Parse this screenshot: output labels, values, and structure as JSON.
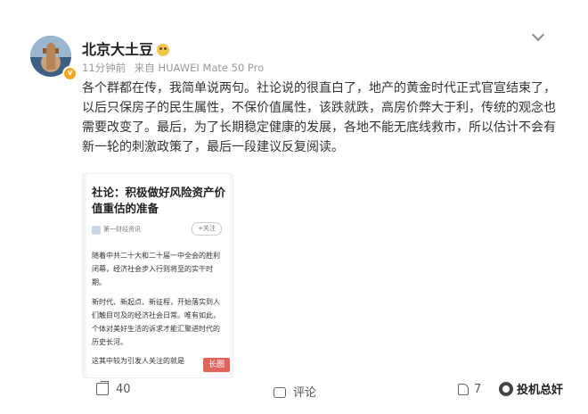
{
  "post": {
    "author": "北京大土豆",
    "time": "11分钟前",
    "source": "来自 HUAWEI Mate 50 Pro",
    "text": "各个群都在传，我简单说两句。社论说的很直白了，地产的黄金时代正式官宣结束了，以后只保房子的民生属性，不保价值属性，该跌就跌，高房价弊大于利，传统的观念也需要改变了。最后，为了长期稳定健康的发展，各地不能无底线救市，所以估计不会有新一轮的刺激政策了，最后一段建议反复阅读。"
  },
  "article": {
    "title": "社论：积极做好风险资产价值重估的准备",
    "source_name": "第一财经资讯",
    "follow_label": "+关注",
    "para1": "随着中共二十大和二十届一中全会的胜利闭幕，经济社会步入行则将至的实干时期。",
    "para2": "新时代、新起点、新征程，开始落实到人们触目可及的经济社会日常。唯有如此，个体对美好生活的诉求才能汇聚进时代的历史长河。",
    "para3": "这其中较为引发人关注的就是",
    "long_badge": "长图"
  },
  "actions": {
    "share_count": "40",
    "comment_label": "评论",
    "like_count": "7"
  },
  "watermark": "投机总奸",
  "icons": [
    "menu-chevron-icon",
    "share-icon",
    "comment-icon",
    "like-icon",
    "fan-badge-icon",
    "verified-badge-icon",
    "watermark-logo-icon"
  ]
}
